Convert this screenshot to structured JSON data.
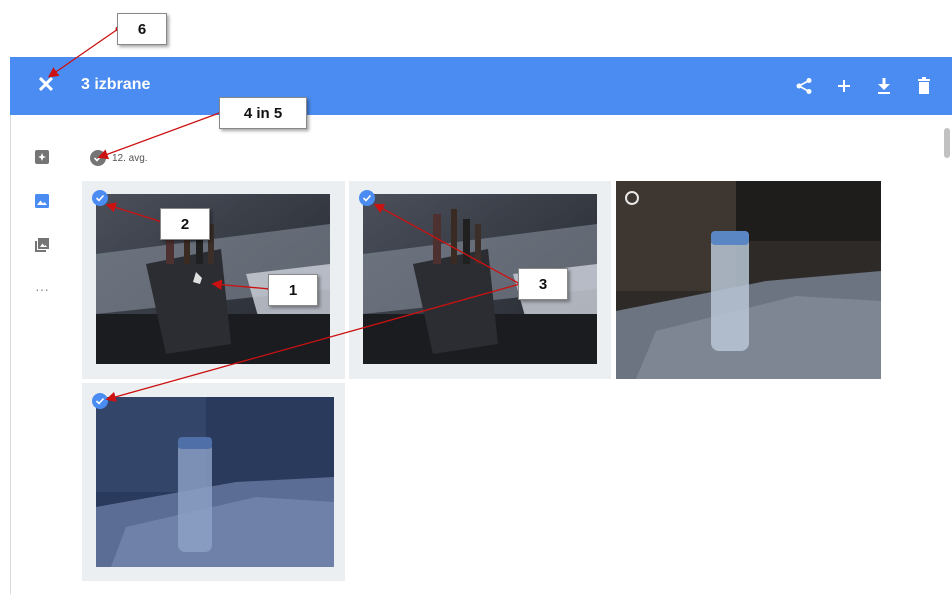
{
  "header": {
    "title": "3 izbrane",
    "close_icon": "close-icon",
    "actions": [
      {
        "name": "share",
        "icon": "share-icon"
      },
      {
        "name": "add",
        "icon": "plus-icon"
      },
      {
        "name": "download",
        "icon": "download-icon"
      },
      {
        "name": "delete",
        "icon": "trash-icon"
      }
    ],
    "accent": "#4a8cf1"
  },
  "sidebar": {
    "items": [
      {
        "name": "assistant",
        "icon": "assistant-icon"
      },
      {
        "name": "photos",
        "icon": "photos-icon",
        "active": true
      },
      {
        "name": "albums",
        "icon": "albums-icon"
      },
      {
        "name": "more",
        "icon": "more-icon",
        "label": "···"
      }
    ]
  },
  "date_section": {
    "label": "12. avg."
  },
  "photos": [
    {
      "name": "pencil-cup-1",
      "selected": true
    },
    {
      "name": "pencil-cup-2",
      "selected": true
    },
    {
      "name": "water-bottle",
      "selected": false
    },
    {
      "name": "water-bottle-2",
      "selected": true
    }
  ],
  "callouts": {
    "c1": "1",
    "c2": "2",
    "c3": "3",
    "c45": "4 in 5",
    "c6": "6"
  },
  "footer": {
    "text": "·"
  }
}
